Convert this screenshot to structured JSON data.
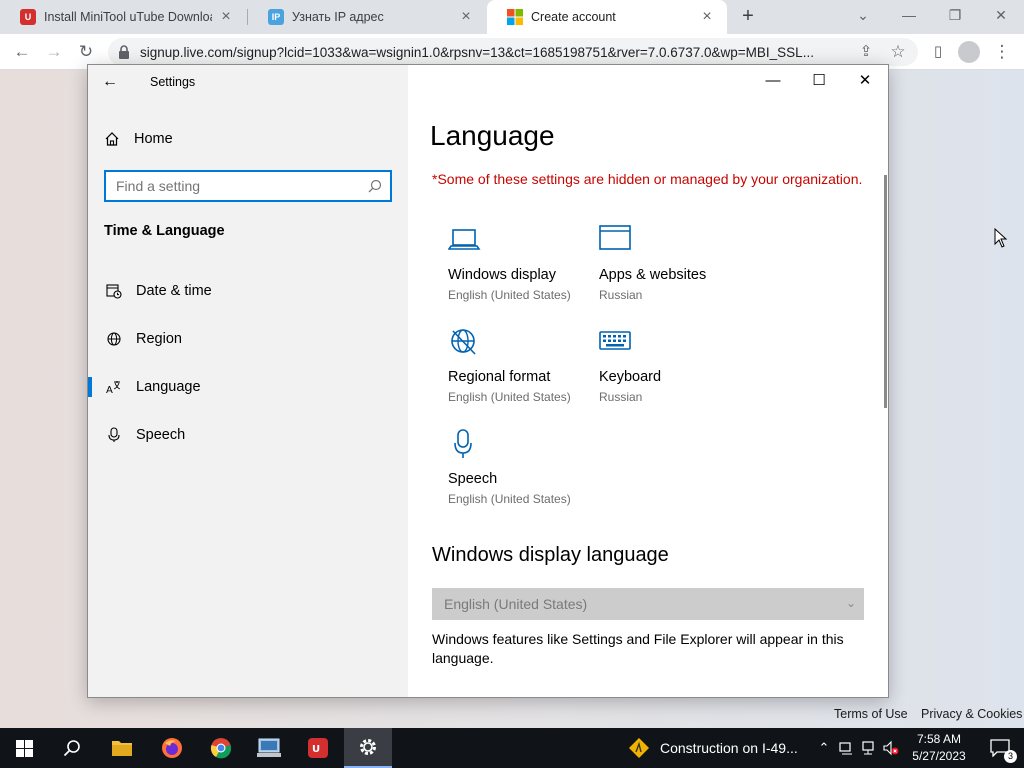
{
  "browser": {
    "tabs": [
      {
        "title": "Install MiniTool uTube Downloader",
        "icon": "utube-icon",
        "active": false
      },
      {
        "title": "Узнать IP адрес",
        "icon": "ip-icon",
        "active": false
      },
      {
        "title": "Create account",
        "icon": "microsoft-icon",
        "active": true
      }
    ],
    "new_tab_label": "+",
    "address": "signup.live.com/signup?lcid=1033&wa=wsignin1.0&rpsnv=13&ct=1685198751&rver=7.0.6737.0&wp=MBI_SSL...",
    "footer": {
      "terms": "Terms of Use",
      "privacy": "Privacy & Cookies"
    }
  },
  "settings": {
    "app_title": "Settings",
    "home_label": "Home",
    "search_placeholder": "Find a setting",
    "section_title": "Time & Language",
    "nav": [
      {
        "label": "Date & time",
        "icon": "calendar-clock-icon"
      },
      {
        "label": "Region",
        "icon": "globe-icon"
      },
      {
        "label": "Language",
        "icon": "language-icon",
        "selected": true
      },
      {
        "label": "Speech",
        "icon": "microphone-icon"
      }
    ],
    "page_title": "Language",
    "warning": "*Some of these settings are hidden or managed by your organization.",
    "tiles": [
      {
        "name": "Windows display",
        "value": "English (United States)",
        "icon": "laptop-icon"
      },
      {
        "name": "Apps & websites",
        "value": "Russian",
        "icon": "window-icon"
      },
      {
        "name": "Regional format",
        "value": "English (United States)",
        "icon": "globe-icon"
      },
      {
        "name": "Keyboard",
        "value": "Russian",
        "icon": "keyboard-icon"
      },
      {
        "name": "Speech",
        "value": "English (United States)",
        "icon": "microphone-icon"
      }
    ],
    "display_language_heading": "Windows display language",
    "display_language_value": "English (United States)",
    "display_language_desc": "Windows features like Settings and File Explorer will appear in this language.",
    "accent_color": "#0078d7",
    "warning_color": "#c50500"
  },
  "taskbar": {
    "news_text": "Construction on I-49...",
    "clock_time": "7:58 AM",
    "clock_date": "5/27/2023",
    "notification_count": "3"
  }
}
